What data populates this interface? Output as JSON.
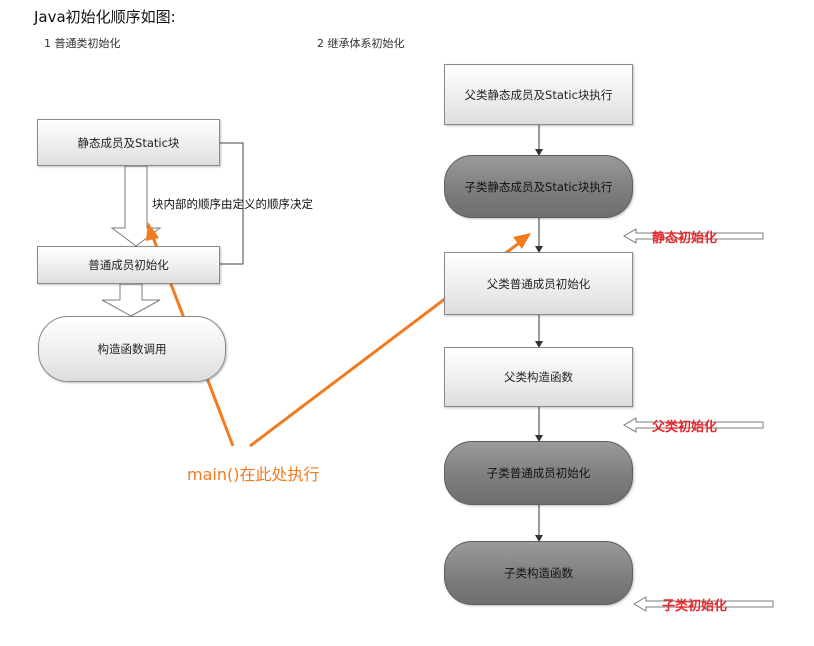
{
  "heading": "Java初始化顺序如图:",
  "section1_title": "1 普通类初始化",
  "section2_title": "2 继承体系初始化",
  "left": {
    "static_block": "静态成员及Static块",
    "instance_init": "普通成员初始化",
    "constructor": "构造函数调用",
    "order_note": "块内部的顺序由定义的顺序决定"
  },
  "right": {
    "parent_static": "父类静态成员及Static块执行",
    "child_static": "子类静态成员及Static块执行",
    "parent_instance": "父类普通成员初始化",
    "parent_constructor": "父类构造函数",
    "child_instance": "子类普通成员初始化",
    "child_constructor": "子类构造函数"
  },
  "labels": {
    "static_init": "静态初始化",
    "parent_init": "父类初始化",
    "child_init": "子类初始化",
    "main_note": "main()在此处执行"
  },
  "colors": {
    "orange": "#f27a1f",
    "red": "#e8262b",
    "dark_box": "#7c7c7c"
  }
}
